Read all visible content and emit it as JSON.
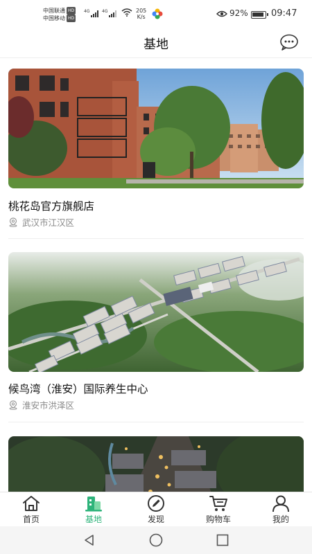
{
  "status_bar": {
    "carrier_1": "中国联通",
    "carrier_2": "中国移动",
    "hd_badge": "HD",
    "network_1": "4G",
    "network_2": "4G",
    "speed_value": "205",
    "speed_unit": "K/s",
    "battery": "92%",
    "time": "09:47"
  },
  "header": {
    "title": "基地",
    "more_icon": "chat-dots-icon"
  },
  "bases": [
    {
      "name": "桃花岛官方旗舰店",
      "location": "武汉市江汉区",
      "image": "apartment-building-photo"
    },
    {
      "name": "候鸟湾（淮安）国际养生中心",
      "location": "淮安市洪泽区",
      "image": "aerial-resort-photo"
    },
    {
      "name": "",
      "location": "",
      "image": "aerial-night-town-photo"
    }
  ],
  "tabs": [
    {
      "label": "首页",
      "icon": "home-icon",
      "active": false
    },
    {
      "label": "基地",
      "icon": "building-icon",
      "active": true
    },
    {
      "label": "发现",
      "icon": "compass-icon",
      "active": false
    },
    {
      "label": "购物车",
      "icon": "cart-icon",
      "active": false
    },
    {
      "label": "我的",
      "icon": "user-icon",
      "active": false
    }
  ],
  "colors": {
    "accent": "#2db37a",
    "text": "#111111",
    "muted": "#888888"
  }
}
